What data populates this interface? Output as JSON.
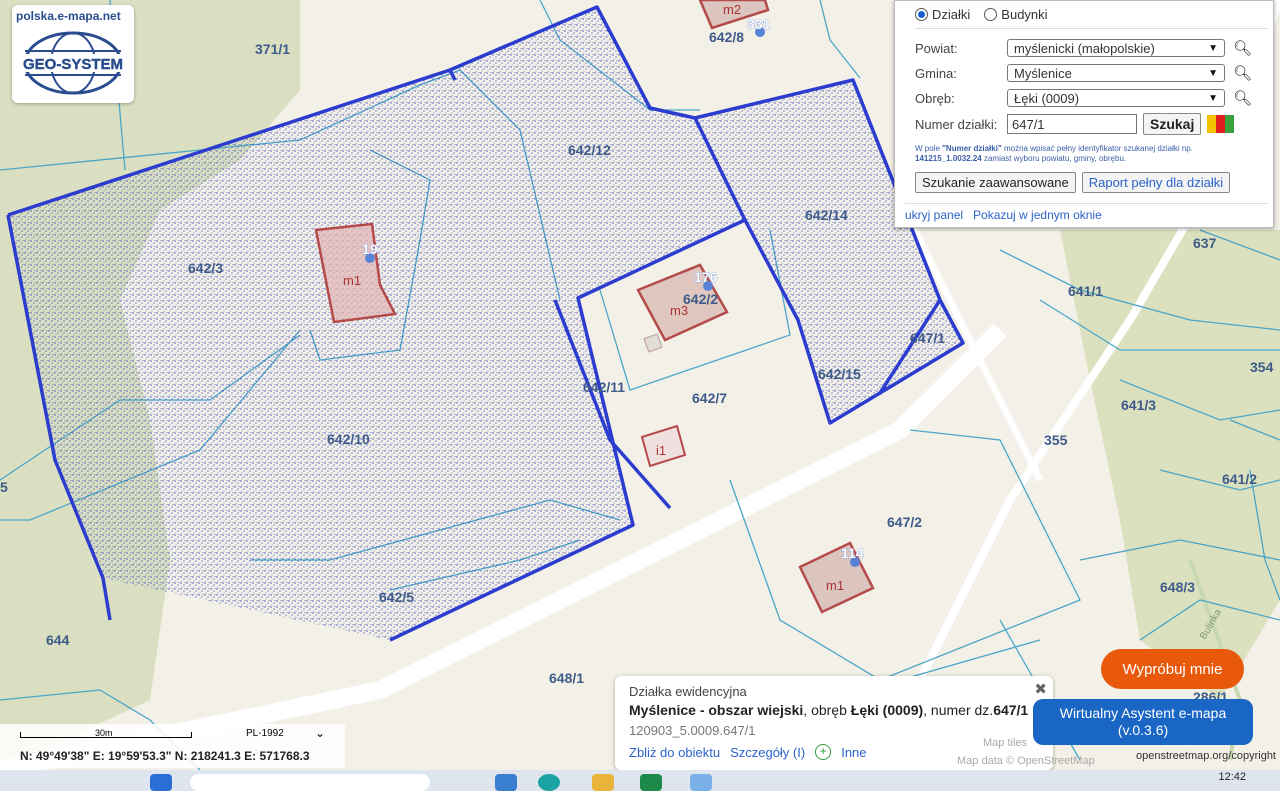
{
  "logo": {
    "url": "polska.e-mapa.net",
    "brand": "GEO-SYSTEM"
  },
  "panel": {
    "radio_dzialki": "Działki",
    "radio_budynki": "Budynki",
    "powiat_label": "Powiat:",
    "powiat_value": "myślenicki (małopolskie)",
    "gmina_label": "Gmina:",
    "gmina_value": "Myślenice",
    "obreb_label": "Obręb:",
    "obreb_value": "Łęki (0009)",
    "numer_label": "Numer działki:",
    "numer_value": "647/1",
    "search_btn": "Szukaj",
    "hint_1": "W pole",
    "hint_bold": "\"Numer działki\"",
    "hint_2": "można wpisać pełny identyfikator szukanej działki np.",
    "hint_example": "141215_1.0032.24",
    "hint_3": "zamiast wyboru powiatu, gminy, obrębu.",
    "advanced_btn": "Szukanie zaawansowane",
    "report_btn": "Raport pełny dla działki",
    "hide_link": "ukryj panel",
    "single_window_link": "Pokazuj w jednym oknie"
  },
  "map_labels": {
    "p371_1": "371/1",
    "p642_12": "642/12",
    "p642_14": "642/14",
    "p642_3": "642/3",
    "p642_2": "642/2",
    "p642_11": "642/11",
    "p642_7": "642/7",
    "p642_15": "642/15",
    "p647_1": "647/1",
    "p642_10": "642/10",
    "p642_5": "642/5",
    "p647_2": "647/2",
    "p641_1": "641/1",
    "p641_3": "641/3",
    "p641_2": "641/2",
    "p637": "637",
    "p354": "354",
    "p355": "355",
    "p648_3": "648/3",
    "p648_1": "648/1",
    "p644": "644",
    "p286_1": "286/1",
    "p642_8": "642/8",
    "p5": "5",
    "street": "Bulinka",
    "b_m2": "m2",
    "b_m1a": "m1",
    "b_m3": "m3",
    "b_i1": "i1",
    "b_m1b": "m1",
    "addr_331": "331",
    "addr_19": "19",
    "addr_176": "176",
    "addr_114": "114"
  },
  "info": {
    "title": "Działka ewidencyjna",
    "place_bold": "Myślenice - obszar wiejski",
    "mid": ", obręb ",
    "obreb_bold": "Łęki (0009)",
    "num_text": ", numer dz.",
    "num_bold": "647/1",
    "id": "120903_5.0009.647/1",
    "zoom_link": "Zbliż do obiektu",
    "details_link": "Szczegóły (I)",
    "other_link": "Inne"
  },
  "try_btn": "Wypróbuj mnie",
  "assistant": {
    "line1": "Wirtualny Asystent e-mapa",
    "line2": "(v.0.3.6)"
  },
  "attrib": {
    "map_tiles": "Map tiles",
    "map_data": "Map data © OpenStreetMap",
    "osm_copyright": "openstreetmap.org/copyright"
  },
  "scale": {
    "distance": "30m",
    "crs": "PL-1992",
    "coords": "N: 49°49'38\"   E: 19°59'53.3\"   N: 218241.3   E: 571768.3"
  },
  "clock": "12:42",
  "colors": {
    "outline": "#2b3ccf",
    "parcel": "#4aa6c9",
    "building": "#b54a4a",
    "accent": "#1966c4",
    "orange": "#e8590c"
  }
}
